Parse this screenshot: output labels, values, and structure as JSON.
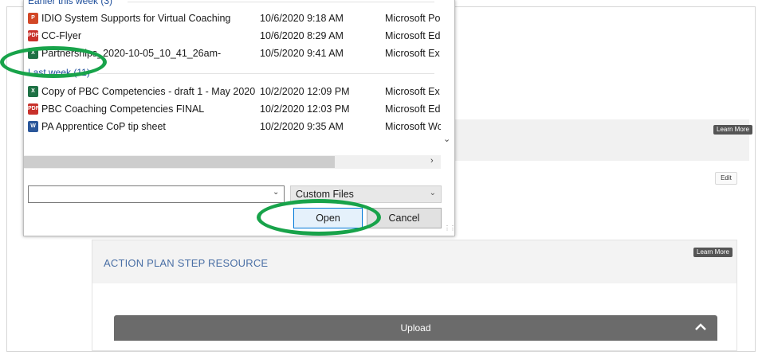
{
  "dialog": {
    "groups": [
      {
        "header": "Earlier this week (3)",
        "rows": [
          {
            "name": "IDIO System Supports for Virtual Coaching",
            "date": "10/6/2020 9:18 AM",
            "type": "Microsoft Po",
            "icon": "powerpoint-file-icon",
            "badge": "P"
          },
          {
            "name": "CC-Flyer",
            "date": "10/6/2020 8:29 AM",
            "type": "Microsoft Ed",
            "icon": "pdf-file-icon",
            "badge": "PDF"
          },
          {
            "name": "Partnerships_2020-10-05_10_41_26am-",
            "date": "10/5/2020 9:41 AM",
            "type": "Microsoft Ex",
            "icon": "excel-file-icon",
            "badge": "X"
          }
        ]
      },
      {
        "header": "Last week (11)",
        "rows": [
          {
            "name": "Copy of PBC Competencies - draft 1 - May 2020",
            "date": "10/2/2020 12:09 PM",
            "type": "Microsoft Ex",
            "icon": "excel-file-icon",
            "badge": "X"
          },
          {
            "name": "PBC Coaching Competencies FINAL",
            "date": "10/2/2020 12:03 PM",
            "type": "Microsoft Ed",
            "icon": "pdf-file-icon",
            "badge": "PDF"
          },
          {
            "name": "PA Apprentice CoP tip sheet",
            "date": "10/2/2020 9:35 AM",
            "type": "Microsoft Wo",
            "icon": "word-file-icon",
            "badge": "W"
          }
        ]
      }
    ],
    "filename_value": "",
    "filter_selected": "Custom Files",
    "open_label": "Open",
    "cancel_label": "Cancel"
  },
  "page": {
    "learn_more_label": "Learn More",
    "edit_label": "Edit",
    "section_title": "ACTION PLAN STEP RESOURCE",
    "upload_label": "Upload"
  },
  "colors": {
    "annotation_green": "#18a34a",
    "group_header_blue": "#1e4e9b",
    "section_title_blue": "#4a6fa5",
    "upload_bar": "#6b6b6b"
  }
}
